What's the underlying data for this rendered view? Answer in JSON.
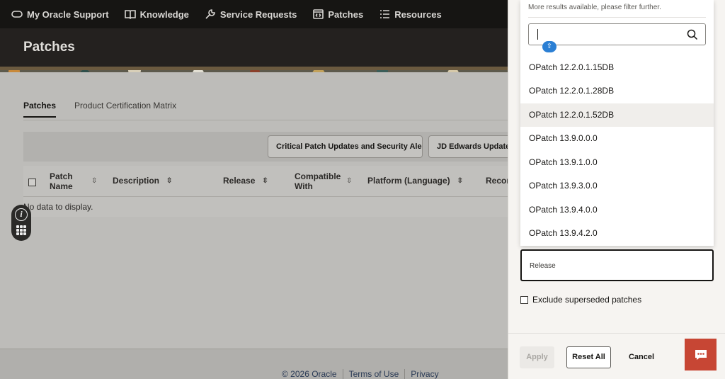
{
  "nav": {
    "items": [
      {
        "label": "My Oracle Support",
        "icon": "oracle-logo-icon"
      },
      {
        "label": "Knowledge",
        "icon": "book-icon"
      },
      {
        "label": "Service Requests",
        "icon": "wrench-icon"
      },
      {
        "label": "Patches",
        "icon": "code-window-icon"
      },
      {
        "label": "Resources",
        "icon": "list-icon"
      }
    ]
  },
  "page": {
    "title": "Patches"
  },
  "tabs": [
    "Patches",
    "Product Certification Matrix"
  ],
  "toolbar": {
    "buttons": [
      "Critical Patch Updates and Security Alerts",
      "JD Edwards Update Center"
    ]
  },
  "table": {
    "columns": [
      "Patch Name",
      "Description",
      "Release",
      "Compatible With",
      "Platform (Language)",
      "Recommended"
    ],
    "empty_text": "No data to display."
  },
  "footer": {
    "links": [
      "© 2026 Oracle",
      "Terms of Use",
      "Privacy"
    ]
  },
  "dropdown": {
    "more_text": "More results available, please filter further.",
    "search_value": "",
    "options": [
      "OPatch 12.2.0.1.15DB",
      "OPatch 12.2.0.1.28DB",
      "OPatch 12.2.0.1.52DB",
      "OPatch 13.9.0.0.0",
      "OPatch 13.9.1.0.0",
      "OPatch 13.9.3.0.0",
      "OPatch 13.9.4.0.0",
      "OPatch 13.9.4.2.0"
    ],
    "highlighted_index": 2
  },
  "filters": {
    "release_label": "Release",
    "exclude_label": "Exclude superseded patches"
  },
  "actions": {
    "apply": "Apply",
    "reset": "Reset All",
    "cancel": "Cancel"
  },
  "colors": {
    "accent": "#c74634",
    "nav_bg": "#161513",
    "badge": "#2b7fd4"
  }
}
